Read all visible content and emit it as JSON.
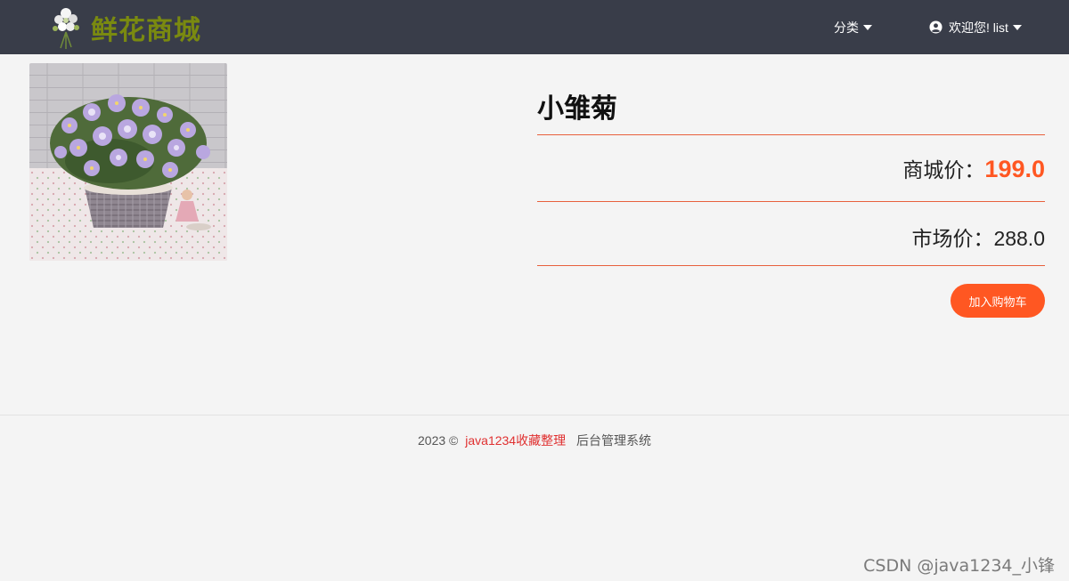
{
  "header": {
    "brand": "鲜花商城",
    "logo_icon": "flower-bouquet-icon",
    "nav_category": "分类",
    "nav_user": "欢迎您! list"
  },
  "product": {
    "name": "小雏菊",
    "mall_price_label": "商城价：",
    "mall_price": "199.0",
    "market_price_label": "市场价：",
    "market_price": "288.0",
    "add_to_cart": "加入购物车",
    "image_alt": "daisy flower basket"
  },
  "footer": {
    "copyright": "2023 ©",
    "link": "java1234收藏整理",
    "admin": "后台管理系统"
  },
  "watermark": "CSDN @java1234_小锋",
  "colors": {
    "header_bg": "#393d49",
    "accent": "#ff5722",
    "brand": "#7a8a10"
  }
}
